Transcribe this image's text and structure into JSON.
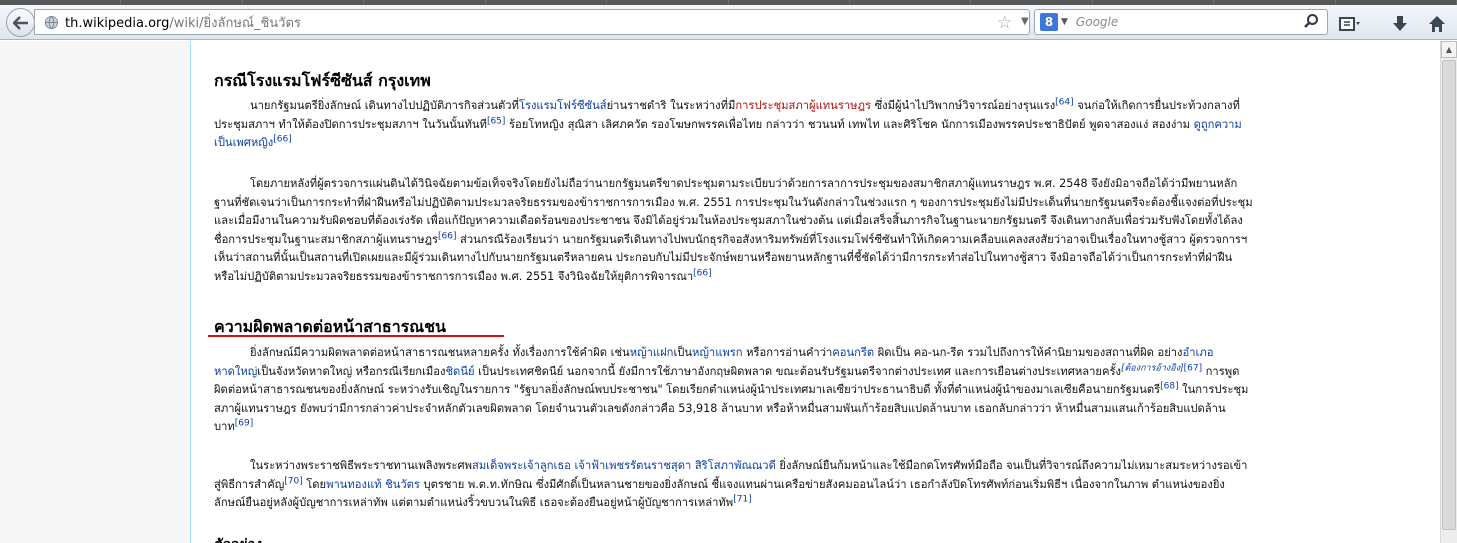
{
  "browser": {
    "url_domain": "th.wikipedia.org",
    "url_path": "/wiki/ยิ่งลักษณ์_ชินวัตร",
    "search_placeholder": "Google",
    "search_logo": "8",
    "icons": [
      "back-arrow-icon",
      "globe-icon",
      "star-icon",
      "reload-icon",
      "search-icon",
      "bookmarks-icon",
      "download-icon",
      "home-icon"
    ]
  },
  "article": {
    "section1": {
      "heading": "กรณีโรงแรมโฟร์ซีซันส์ กรุงเทพ",
      "p1": [
        {
          "parts": [
            {
              "t": "นายกรัฐมนตรียิ่งลักษณ์ เดินทางไปปฏิบัติภารกิจส่วนตัวที่"
            },
            {
              "t": "โรงแรมโฟร์ซีซันส์",
              "k": "link"
            },
            {
              "t": "ย่านราชดำริ ในระหว่างที่มี"
            },
            {
              "t": "การประชุมสภาผู้แทนราษฎร",
              "k": "red"
            },
            {
              "t": " ซึ่งมีผู้นำไปวิพากษ์วิจารณ์อย่างรุนแรง"
            },
            {
              "t": "[64]",
              "k": "sup"
            },
            {
              "t": " จนก่อให้เกิดการยื่นประท้วงกลางที่"
            }
          ]
        },
        {
          "parts": [
            {
              "t": "ประชุมสภาฯ ทำให้ต้องปิดการประชุมสภาฯ ในวันนั้นทันที"
            },
            {
              "t": "[65]",
              "k": "sup"
            },
            {
              "t": " ร้อยโทหญิง สุณิสา เลิศภควัต รองโฆษกพรรคเพื่อไทย กล่าวว่า ชวนนท์ เทพไท และศิริโชค นักการเมืองพรรคประชาธิปัตย์ พูดจาสองแง่ สองง่าม "
            },
            {
              "t": "ดูถูกความ",
              "k": "link"
            }
          ]
        },
        {
          "parts": [
            {
              "t": "เป็นเพศหญิง",
              "k": "link"
            },
            {
              "t": "[66]",
              "k": "sup"
            }
          ]
        }
      ],
      "p2": [
        {
          "parts": [
            {
              "t": "โดยภายหลังที่ผู้ตรวจการแผ่นดินได้วินิจฉัยตามข้อเท็จจริงโดยยังไม่ถือว่านายกรัฐมนตรีขาดประชุมตามระเบียบว่าด้วยการลาการประชุมของสมาชิกสภาผู้แทนราษฎร พ.ศ. 2548 จึงยังมิอาจถือได้ว่ามีพยานหลัก"
            }
          ]
        },
        {
          "parts": [
            {
              "t": "ฐานที่ชัดเจนว่าเป็นการกระทำที่ฝ่าฝืนหรือไม่ปฏิบัติตามประมวลจริยธรรมของข้าราชการการเมือง พ.ศ. 2551 การประชุมในวันดังกล่าวในช่วงแรก ๆ ของการประชุมยังไม่มีประเด็นที่นายกรัฐมนตรีจะต้องชี้แจงต่อที่ประชุม"
            }
          ]
        },
        {
          "parts": [
            {
              "t": "และเมื่อมีงานในความรับผิดชอบที่ต้องเร่งรัด เพื่อแก้ปัญหาความเดือดร้อนของประชาชน จึงมิได้อยู่ร่วมในห้องประชุมสภาในช่วงต้น แต่เมื่อเสร็จสิ้นภารกิจในฐานะนายกรัฐมนตรี จึงเดินทางกลับเพื่อร่วมรับฟังโดยทั้งได้ลง"
            }
          ]
        },
        {
          "parts": [
            {
              "t": "ชื่อการประชุมในฐานะสมาชิกสภาผู้แทนราษฎร"
            },
            {
              "t": "[66]",
              "k": "sup"
            },
            {
              "t": " ส่วนกรณีร้องเรียนว่า นายกรัฐมนตรีเดินทางไปพบนักธุรกิจอสังหาริมทรัพย์ที่โรงแรมโฟร์ซีซันทำให้เกิดความเคลือบแคลงสงสัยว่าอาจเป็นเรื่องในทางชู้สาว ผู้ตรวจการฯ"
            }
          ]
        },
        {
          "parts": [
            {
              "t": "เห็นว่าสถานที่นั้นเป็นสถานที่เปิดเผยและมีผู้ร่วมเดินทางไปกับนายกรัฐมนตรีหลายคน ประกอบกับไม่มีประจักษ์พยานหรือพยานหลักฐานที่ชี้ชัดได้ว่ามีการกระทำส่อไปในทางชู้สาว จึงมิอาจถือได้ว่าเป็นการกระทำที่ฝ่าฝืน"
            }
          ]
        },
        {
          "parts": [
            {
              "t": "หรือไม่ปฏิบัติตามประมวลจริยธรรมของข้าราชการการเมือง พ.ศ. 2551 จึงวินิจฉัยให้ยุติการพิจารณา"
            },
            {
              "t": "[66]",
              "k": "sup"
            }
          ]
        }
      ]
    },
    "section2": {
      "heading": "ความผิดพลาดต่อหน้าสาธารณชน",
      "p1": [
        {
          "parts": [
            {
              "t": "ยิ่งลักษณ์มีความผิดพลาดต่อหน้าสาธารณชนหลายครั้ง ทั้งเรื่องการใช้คำผิด เช่น"
            },
            {
              "t": "หญ้าแฝก",
              "k": "link"
            },
            {
              "t": "เป็น"
            },
            {
              "t": "หญ้าแพรก",
              "k": "link"
            },
            {
              "t": " หรือการอ่านคำว่า"
            },
            {
              "t": "คอนกรีต",
              "k": "link"
            },
            {
              "t": " ผิดเป็น คอ-นก-รีต รวมไปถึงการให้คำนิยามของสถานที่ผิด อย่าง"
            },
            {
              "t": "อำเภอ",
              "k": "link"
            }
          ]
        },
        {
          "parts": [
            {
              "t": "หาดใหญ่",
              "k": "link"
            },
            {
              "t": "เป็นจังหวัดหาดใหญ่ หรือกรณีเรียกเมือง"
            },
            {
              "t": "ชิดนีย์",
              "k": "link"
            },
            {
              "t": " เป็นประเทศชิดนีย์ นอกจากนี้ ยังมีการใช้ภาษาอังกฤษผิดพลาด ขณะต้อนรับรัฐมนตรีจากต่างประเทศ และการเยือนต่างประเทศหลายครั้ง"
            },
            {
              "t": "[ต้องการอ้างอิง]",
              "k": "supi"
            },
            {
              "t": "[67]",
              "k": "sup"
            },
            {
              "t": " การพูด"
            }
          ]
        },
        {
          "parts": [
            {
              "t": "ผิดต่อหน้าสาธารณชนของยิ่งลักษณ์ ระหว่างรับเชิญในรายการ \"รัฐบาลยิ่งลักษณ์พบประชาชน\" โดยเรียกตำแหน่งผู้นำประเทศมาเลเซียว่าประธานาธิบดี ทั้งที่ตำแหน่งผู้นำของมาเลเซียคือนายกรัฐมนตรี"
            },
            {
              "t": "[68]",
              "k": "sup"
            },
            {
              "t": " ในการประชุม"
            }
          ]
        },
        {
          "parts": [
            {
              "t": "สภาผู้แทนราษฎร ยังพบว่ามีการกล่าวค่าประจำหลักตัวเลขผิดพลาด โดยจำนวนตัวเลขดังกล่าวคือ 53,918 ล้านบาท หรือห้าหมื่นสามพันเก้าร้อยสิบแปดล้านบาท เธอกลับกล่าวว่า ห้าหมื่นสามแสนเก้าร้อยสิบแปดล้าน"
            }
          ]
        },
        {
          "parts": [
            {
              "t": "บาท"
            },
            {
              "t": "[69]",
              "k": "sup"
            }
          ]
        }
      ],
      "p2": [
        {
          "parts": [
            {
              "t": "ในระหว่างพระราชพิธีพระราชทานเพลิงพระศพ"
            },
            {
              "t": "สมเด็จพระเจ้าลูกเธอ เจ้าฟ้าเพชรรัตนราชสุดา สิริโสภาพัณณวดี",
              "k": "link"
            },
            {
              "t": " ยิ่งลักษณ์ยืนก้มหน้าและใช้มือกดโทรศัพท์มือถือ จนเป็นที่วิจารณ์ถึงความไม่เหมาะสมระหว่างรอเข้า"
            }
          ]
        },
        {
          "parts": [
            {
              "t": "สู่พิธีการสำคัญ"
            },
            {
              "t": "[70]",
              "k": "sup"
            },
            {
              "t": " โดย"
            },
            {
              "t": "พานทองแท้ ชินวัตร",
              "k": "link"
            },
            {
              "t": " บุตรชาย พ.ต.ท.ทักษิณ ซึ่งมีศักดิ์เป็นหลานชายของยิ่งลักษณ์ ชี้แจงแทนผ่านเครือข่ายสังคมออนไลน์ว่า เธอกำลังปิดโทรศัพท์ก่อนเริ่มพิธีฯ เนื่องจากในภาพ ตำแหน่งของยิ่ง"
            }
          ]
        },
        {
          "parts": [
            {
              "t": "ลักษณ์ยืนอยู่หลังผู้บัญชาการเหล่าทัพ แต่ตามตำแหน่งริ้วขบวนในพิธี เธอจะต้องยืนอยู่หน้าผู้บัญชาการเหล่าทัพ"
            },
            {
              "t": "[71]",
              "k": "sup"
            }
          ]
        }
      ]
    },
    "next_heading_partial": "ตัวอย่าง"
  }
}
